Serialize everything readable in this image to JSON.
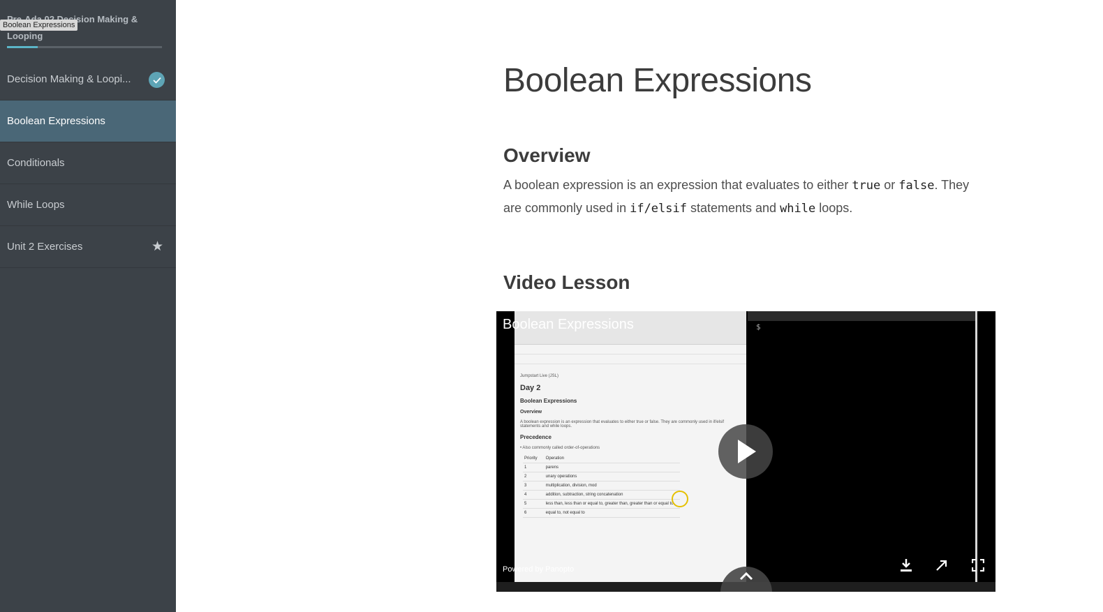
{
  "sidebar": {
    "course_title": "Pre-Ada 02 Decision Making & Looping",
    "tooltip": "Boolean Expressions",
    "progress_fraction": 0.2,
    "items": [
      {
        "label": "Decision Making & Loopi...",
        "icon": "check-icon",
        "active": false
      },
      {
        "label": "Boolean Expressions",
        "active": true
      },
      {
        "label": "Conditionals",
        "active": false
      },
      {
        "label": "While Loops",
        "active": false
      },
      {
        "label": "Unit 2 Exercises",
        "icon": "star-icon",
        "active": false
      }
    ]
  },
  "main": {
    "title": "Boolean Expressions",
    "overview_heading": "Overview",
    "overview": {
      "t1": "A boolean expression is an expression that evaluates to either ",
      "c1": "true",
      "t2": " or ",
      "c2": "false",
      "t3": ". They are commonly used in ",
      "c3": "if/elsif",
      "t4": " statements and ",
      "c4": "while",
      "t5": " loops."
    },
    "video_heading": "Video Lesson"
  },
  "video": {
    "title": "Boolean Expressions",
    "powered_by": "Powered by Panopto",
    "prompt": "$",
    "doc": {
      "label": "Jumpstart Live (JSL)",
      "day": "Day 2",
      "heading": "Boolean Expressions",
      "overview": "Overview",
      "text": "A boolean expression is an expression that evaluates to either true or false. They are commonly used in if/elsif statements and while loops.",
      "precedence": "Precedence",
      "bullet": "• Also commonly called order-of-operations",
      "table_headers": [
        "Priority",
        "Operation"
      ],
      "table_rows": [
        [
          "1",
          "parens"
        ],
        [
          "2",
          "unary operations"
        ],
        [
          "3",
          "multiplication, division, mod"
        ],
        [
          "4",
          "addition, subtraction, string concatenation"
        ],
        [
          "5",
          "less than, less than or equal to, greater than, greater than or equal to"
        ],
        [
          "6",
          "equal to, not equal to"
        ]
      ]
    }
  },
  "colors": {
    "sidebar_bg": "#3c4248",
    "active_bg": "#4a6777",
    "accent": "#5bb5c8"
  }
}
